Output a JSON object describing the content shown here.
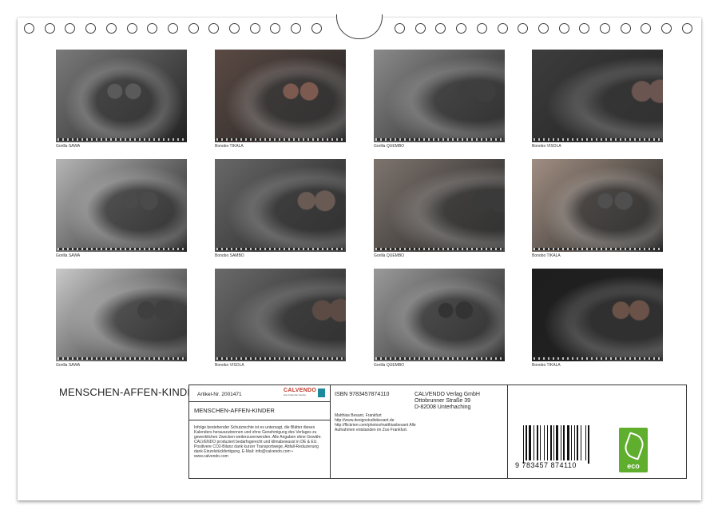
{
  "calendar": {
    "title": "MENSCHEN-AFFEN-KINDER",
    "photos": [
      {
        "caption": "Gorilla SAWA",
        "tone": "#7a7a7a",
        "face": "#5a5a5a"
      },
      {
        "caption": "Bonobo TIKALA",
        "tone": "#5b4a44",
        "face": "#7d5a4f"
      },
      {
        "caption": "Gorilla QUEMBO",
        "tone": "#8a8a8a",
        "face": "#3e3e3e"
      },
      {
        "caption": "Bonobo VISOLA",
        "tone": "#3d3d3d",
        "face": "#6b5550"
      },
      {
        "caption": "Gorilla SAWA",
        "tone": "#b5b5b5",
        "face": "#4a4a4a"
      },
      {
        "caption": "Bonobo SAMBO",
        "tone": "#686868",
        "face": "#6a5a54"
      },
      {
        "caption": "Gorilla QUEMBO",
        "tone": "#7e746e",
        "face": "#3a3a3a"
      },
      {
        "caption": "Bonobo TIKALA",
        "tone": "#a08e82",
        "face": "#4f4f4f"
      },
      {
        "caption": "Gorilla SAWA",
        "tone": "#c9c9c9",
        "face": "#3f3f3f"
      },
      {
        "caption": "Bonobo VISOLA",
        "tone": "#6a6a6a",
        "face": "#5b4b44"
      },
      {
        "caption": "Gorilla QUEMBO",
        "tone": "#9a9a9a",
        "face": "#333333"
      },
      {
        "caption": "Bonobo TIKALA",
        "tone": "#1e1e1e",
        "face": "#6a5248"
      }
    ]
  },
  "info": {
    "artikel": "Artikel-Nr. 2001471",
    "brand": "CALVENDO",
    "brand_tag": "Hier Kalender kaufen",
    "product_title": "MENSCHEN-AFFEN-KINDER",
    "legal": "Infolge bestehender Schutzrechte ist es untersagt, die Blätter dieses Kalenders herauszutrennen und ohne Genehmigung des Verlages zu gewerblichen Zwecken weiterzuverwenden. Alle Angaben ohne Gewähr. CALVENDO produziert bedarfsgerecht und klimabewusst in DE & EU. Positivere CO2-Bilanz dank kurzer Transportwege, Abfall-Reduzierung dank Einzelstückfertigung. E-Mail: info@calvendo.com • www.calvendo.com",
    "isbn": "ISBN 9783457874110",
    "publisher": "CALVENDO Verlag GmbH",
    "street": "Ottobrunner Straße 39",
    "city": "D-82008 Unterhaching",
    "credits": "Matthias Besant, Frankfurt http://www.designstudiobesant.de http://flickrierr.com/photos/matthiasbesant Alle Aufnahmen entstanden im Zoo Frankfurt.",
    "barcode_digits": "9 783457 874110",
    "eco_label": "eco"
  },
  "colors": {
    "eco_green": "#5fae2e",
    "brand_red": "#c0392b",
    "brand_teal": "#1b8a9a"
  }
}
